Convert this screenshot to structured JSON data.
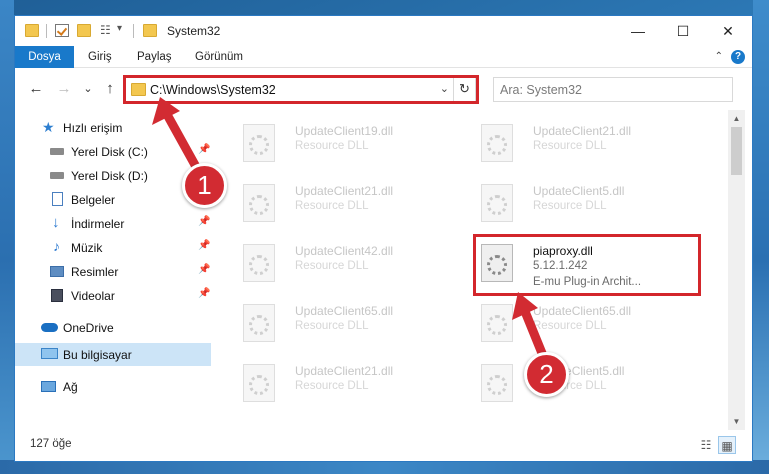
{
  "window": {
    "title": "System32",
    "controls": {
      "minimize": "—",
      "maximize": "☐",
      "close": "✕"
    }
  },
  "ribbon": {
    "tabs": [
      {
        "label": "Dosya",
        "active": true
      },
      {
        "label": "Giriş"
      },
      {
        "label": "Paylaş"
      },
      {
        "label": "Görünüm"
      }
    ],
    "help": "?",
    "collapse": "⌃"
  },
  "navigation": {
    "back": "←",
    "forward": "→",
    "recent": "⌄",
    "up": "↑",
    "address": "C:\\Windows\\System32",
    "dropdown": "⌄",
    "refresh": "↻",
    "search_placeholder": "Ara: System32"
  },
  "sidebar": {
    "items": [
      {
        "label": "Hızlı erişim",
        "icon": "star-icon",
        "pinned": false
      },
      {
        "label": "Yerel Disk (C:)",
        "icon": "drive-icon",
        "pinned": true
      },
      {
        "label": "Yerel Disk (D:)",
        "icon": "drive-icon",
        "pinned": true
      },
      {
        "label": "Belgeler",
        "icon": "documents-icon",
        "pinned": true
      },
      {
        "label": "İndirmeler",
        "icon": "downloads-icon",
        "pinned": true
      },
      {
        "label": "Müzik",
        "icon": "music-icon",
        "pinned": true
      },
      {
        "label": "Resimler",
        "icon": "pictures-icon",
        "pinned": true
      },
      {
        "label": "Videolar",
        "icon": "videos-icon",
        "pinned": true
      },
      {
        "label": "OneDrive",
        "icon": "cloud-icon",
        "pinned": false
      },
      {
        "label": "Bu bilgisayar",
        "icon": "computer-icon",
        "pinned": false,
        "selected": true
      },
      {
        "label": "Ağ",
        "icon": "network-icon",
        "pinned": false
      }
    ],
    "pin_glyph": "📌"
  },
  "files": [
    {
      "name": "UpdateClient19.dll",
      "type": "Resource DLL"
    },
    {
      "name": "UpdateClient21.dll",
      "type": "Resource DLL"
    },
    {
      "name": "UpdateClient21.dll",
      "type": "Resource DLL"
    },
    {
      "name": "UpdateClient5.dll",
      "type": "Resource DLL"
    },
    {
      "name": "UpdateClient42.dll",
      "type": "Resource DLL"
    },
    {
      "name": "piaproxy.dll",
      "type": "5.12.1.242",
      "description": "E-mu Plug-in Archit...",
      "highlighted": true
    },
    {
      "name": "UpdateClient65.dll",
      "type": "Resource DLL"
    },
    {
      "name": "UpdateClient65.dll",
      "type": "Resource DLL"
    },
    {
      "name": "UpdateClient21.dll",
      "type": "Resource DLL"
    },
    {
      "name": "UpdateClient5.dll",
      "type": "Resource DLL"
    }
  ],
  "scrollbar": {
    "up": "▲",
    "down": "▼"
  },
  "status": {
    "count": "127 öğe",
    "view_details": "☷",
    "view_icons": "▦"
  },
  "annotations": [
    {
      "number": "1",
      "color": "#d22b32"
    },
    {
      "number": "2",
      "color": "#d22b32"
    }
  ]
}
